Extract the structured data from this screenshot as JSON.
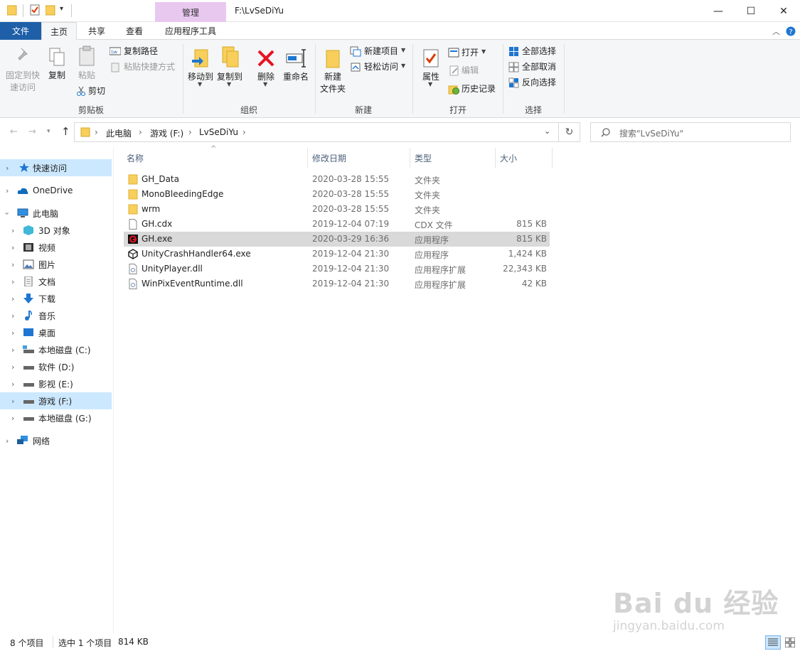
{
  "titlebar": {
    "contextual_tab": "管理",
    "path": "F:\\LvSeDiYu",
    "minimize": "—",
    "maximize": "☐",
    "close": "✕"
  },
  "tabs": {
    "file": "文件",
    "home": "主页",
    "share": "共享",
    "view": "查看",
    "app_tools": "应用程序工具"
  },
  "ribbon": {
    "clipboard": {
      "pin": "固定到快\n速访问",
      "copy": "复制",
      "paste": "粘贴",
      "copy_path": "复制路径",
      "paste_shortcut": "粘贴快捷方式",
      "cut": "剪切",
      "group": "剪贴板"
    },
    "organize": {
      "move_to": "移动到",
      "copy_to": "复制到",
      "delete": "删除",
      "rename": "重命名",
      "group": "组织"
    },
    "new": {
      "new_folder": "新建\n文件夹",
      "new_item": "新建项目",
      "easy_access": "轻松访问",
      "group": "新建"
    },
    "open": {
      "properties": "属性",
      "open": "打开",
      "edit": "编辑",
      "history": "历史记录",
      "group": "打开"
    },
    "select": {
      "select_all": "全部选择",
      "select_none": "全部取消",
      "invert": "反向选择",
      "group": "选择"
    }
  },
  "address": {
    "crumbs": [
      "此电脑",
      "游戏 (F:)",
      "LvSeDiYu"
    ],
    "search_placeholder": "搜索\"LvSeDiYu\""
  },
  "nav": {
    "items": [
      {
        "label": "快速访问",
        "icon": "star-icon",
        "selected": true
      },
      {
        "label": "OneDrive",
        "icon": "cloud-icon"
      },
      {
        "label": "此电脑",
        "icon": "computer-icon"
      },
      {
        "label": "3D 对象",
        "icon": "cube-icon"
      },
      {
        "label": "视频",
        "icon": "video-icon"
      },
      {
        "label": "图片",
        "icon": "picture-icon"
      },
      {
        "label": "文档",
        "icon": "document-icon"
      },
      {
        "label": "下载",
        "icon": "download-icon"
      },
      {
        "label": "音乐",
        "icon": "music-icon"
      },
      {
        "label": "桌面",
        "icon": "desktop-icon"
      },
      {
        "label": "本地磁盘 (C:)",
        "icon": "drive-icon"
      },
      {
        "label": "软件 (D:)",
        "icon": "drive-icon"
      },
      {
        "label": "影视 (E:)",
        "icon": "drive-icon"
      },
      {
        "label": "游戏 (F:)",
        "icon": "drive-icon",
        "selected": true
      },
      {
        "label": "本地磁盘 (G:)",
        "icon": "drive-icon"
      },
      {
        "label": "网络",
        "icon": "network-icon"
      }
    ]
  },
  "columns": {
    "name": "名称",
    "modified": "修改日期",
    "type": "类型",
    "size": "大小"
  },
  "files": [
    {
      "name": "GH_Data",
      "modified": "2020-03-28 15:55",
      "type": "文件夹",
      "size": "",
      "icon": "folder-icon"
    },
    {
      "name": "MonoBleedingEdge",
      "modified": "2020-03-28 15:55",
      "type": "文件夹",
      "size": "",
      "icon": "folder-icon"
    },
    {
      "name": "wrm",
      "modified": "2020-03-28 15:55",
      "type": "文件夹",
      "size": "",
      "icon": "folder-icon"
    },
    {
      "name": "GH.cdx",
      "modified": "2019-12-04 07:19",
      "type": "CDX 文件",
      "size": "815 KB",
      "icon": "file-icon"
    },
    {
      "name": "GH.exe",
      "modified": "2020-03-29 16:36",
      "type": "应用程序",
      "size": "815 KB",
      "icon": "exe-icon",
      "selected": true
    },
    {
      "name": "UnityCrashHandler64.exe",
      "modified": "2019-12-04 21:30",
      "type": "应用程序",
      "size": "1,424 KB",
      "icon": "unity-icon"
    },
    {
      "name": "UnityPlayer.dll",
      "modified": "2019-12-04 21:30",
      "type": "应用程序扩展",
      "size": "22,343 KB",
      "icon": "dll-icon"
    },
    {
      "name": "WinPixEventRuntime.dll",
      "modified": "2019-12-04 21:30",
      "type": "应用程序扩展",
      "size": "42 KB",
      "icon": "dll-icon"
    }
  ],
  "status": {
    "count": "8 个项目",
    "selected": "选中 1 个项目",
    "selected_size": "814 KB"
  },
  "watermark": {
    "logo": "Bai du 经验",
    "url": "jingyan.baidu.com"
  }
}
